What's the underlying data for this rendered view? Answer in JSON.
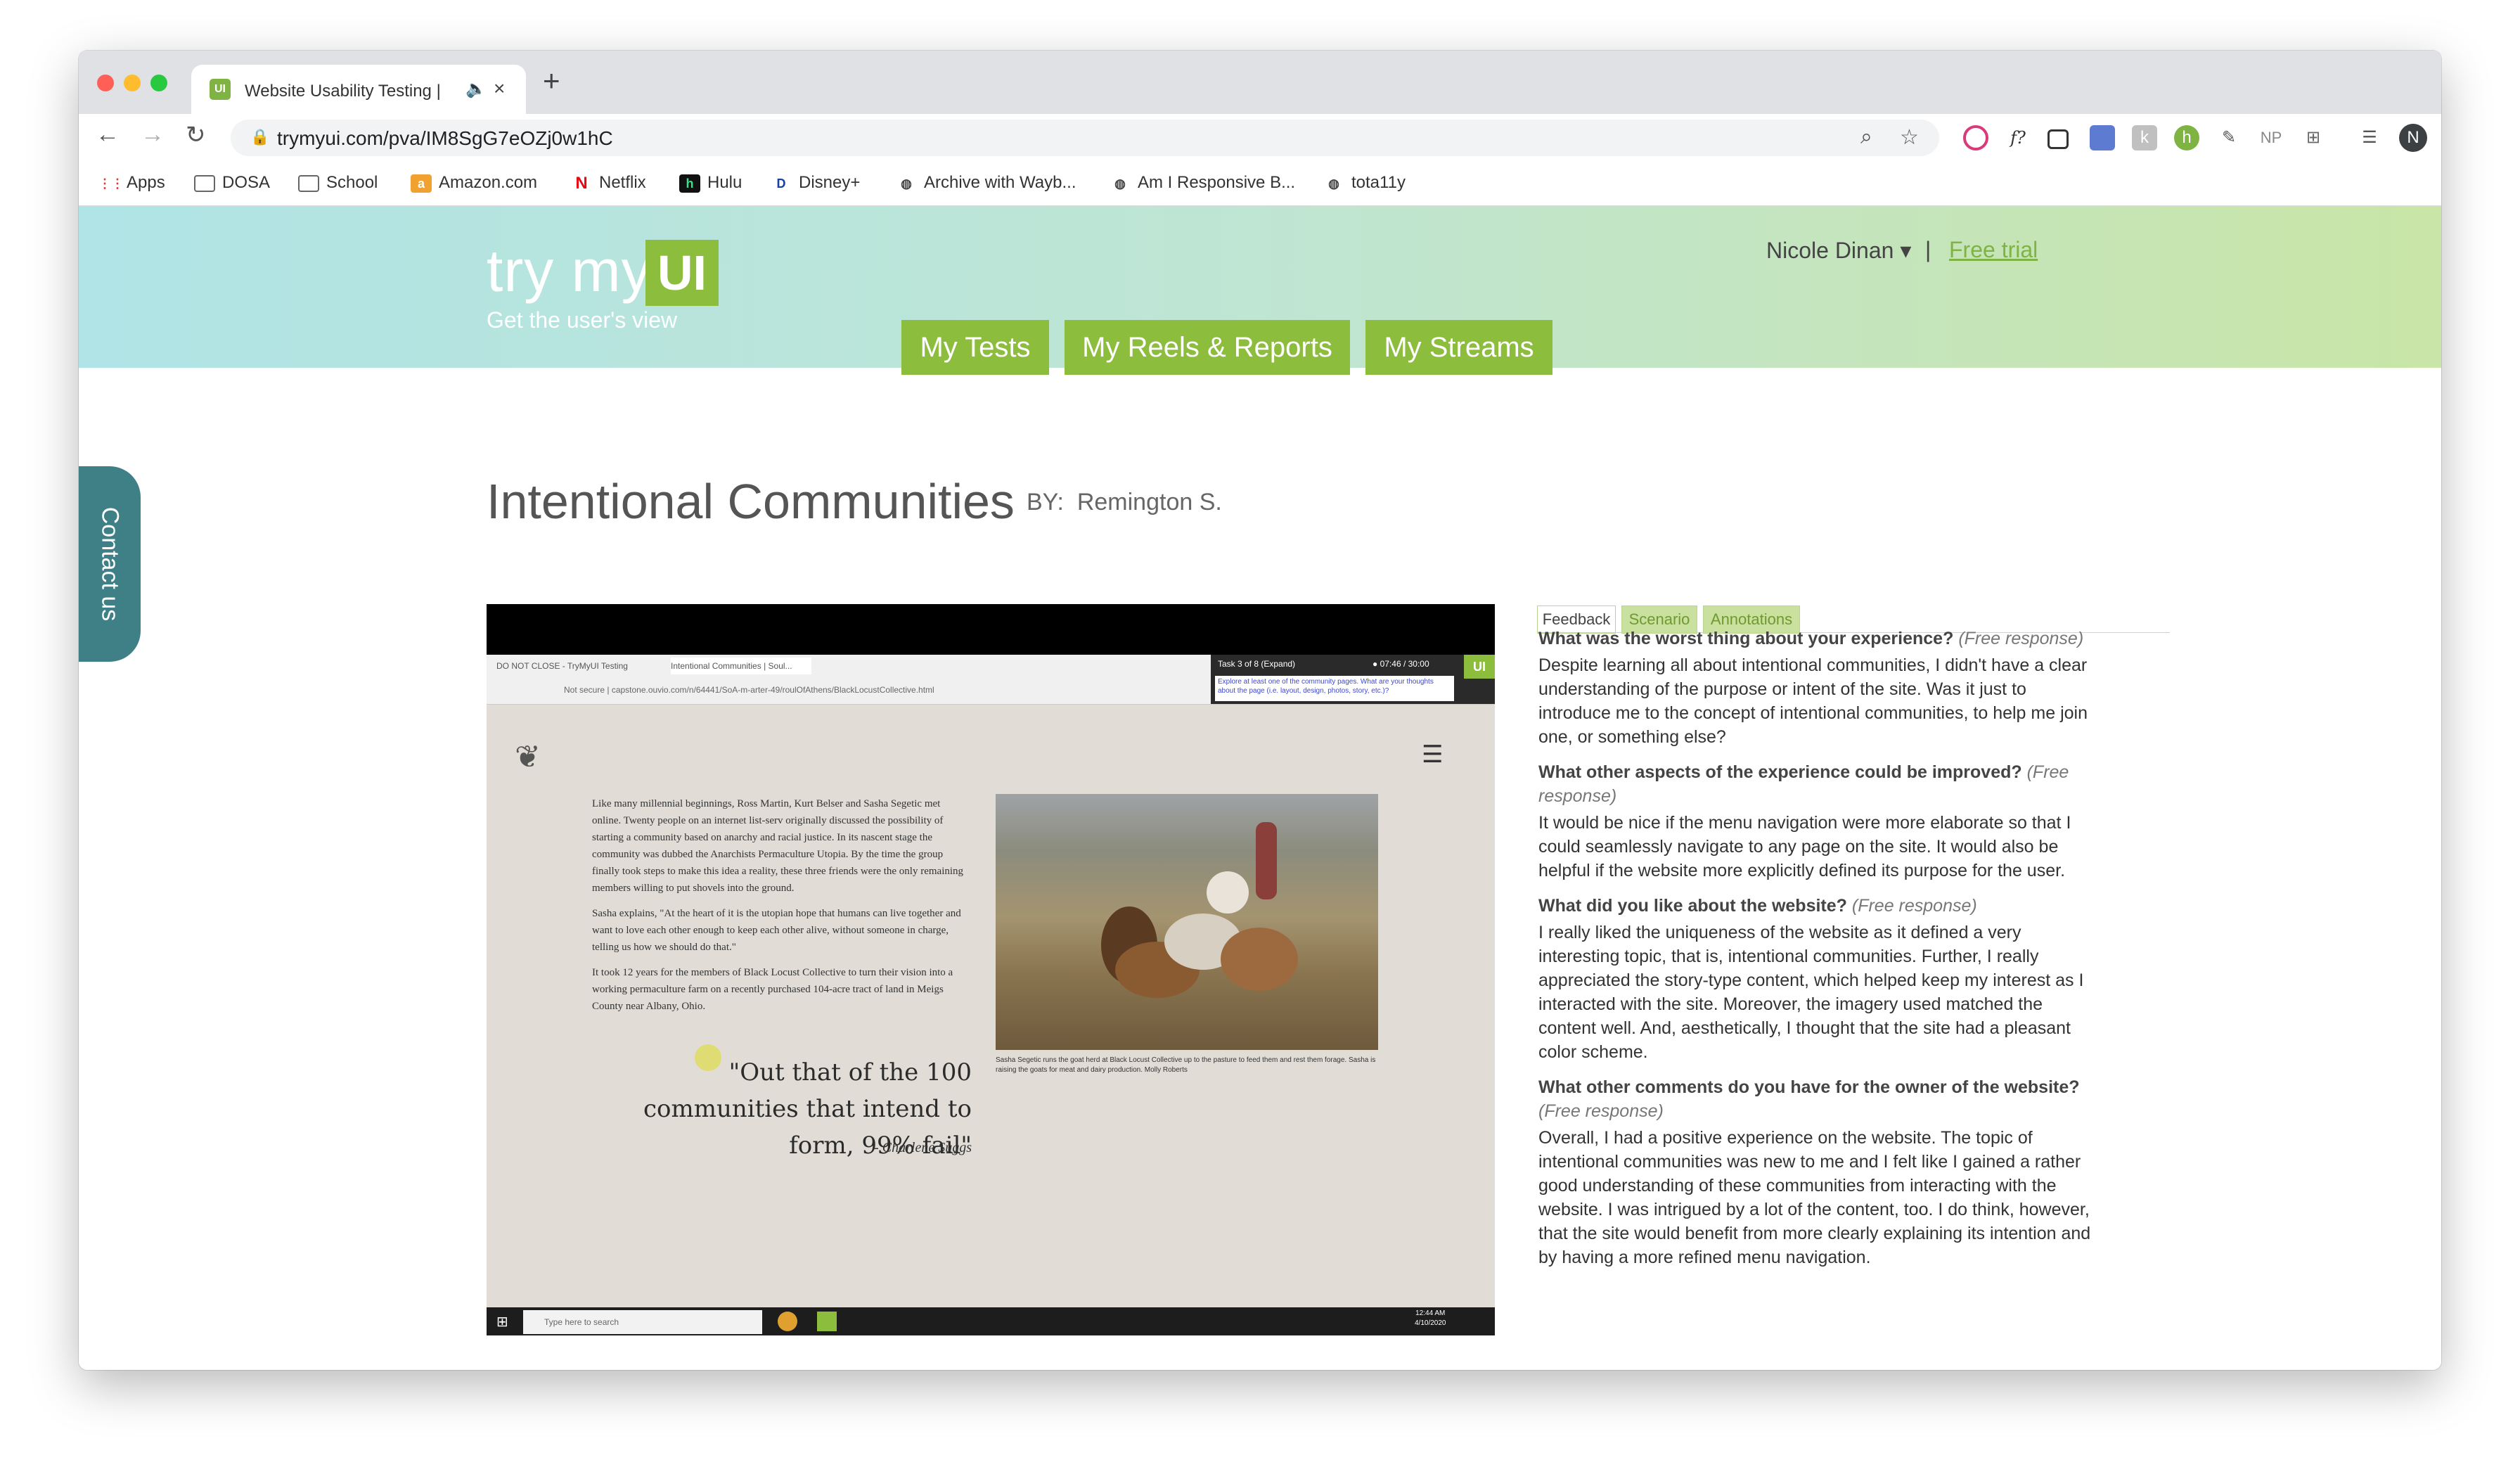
{
  "browser": {
    "tab_title": "Website Usability Testing |",
    "tab_favicon": "UI",
    "url": "trymyui.com/pva/IM8SgG7eOZj0w1hC",
    "profile_initial": "N",
    "ext_np": "NP",
    "ext_fx": "f?"
  },
  "bookmarks": [
    {
      "icon": "apps-grid-icon",
      "label": "Apps"
    },
    {
      "icon": "folder-icon",
      "label": "DOSA"
    },
    {
      "icon": "folder-icon",
      "label": "School"
    },
    {
      "icon": "amazon-icon",
      "label": "Amazon.com"
    },
    {
      "icon": "netflix-icon",
      "label": "Netflix"
    },
    {
      "icon": "hulu-icon",
      "label": "Hulu"
    },
    {
      "icon": "disney-icon",
      "label": "Disney+"
    },
    {
      "icon": "globe-icon",
      "label": "Archive with Wayb..."
    },
    {
      "icon": "globe-icon",
      "label": "Am I Responsive B..."
    },
    {
      "icon": "globe-icon",
      "label": "tota11y"
    }
  ],
  "header": {
    "logo_text": "try my",
    "logo_box": "UI",
    "tagline": "Get the user's view",
    "nav": [
      "My Tests",
      "My Reels & Reports",
      "My Streams"
    ],
    "user": "Nicole Dinan ▾",
    "separator": "|",
    "free_trial": "Free trial"
  },
  "contact_label": "Contact us",
  "test": {
    "title": "Intentional Communities",
    "by_label": "BY:",
    "author": "Remington S."
  },
  "video": {
    "tabs": [
      "DO NOT CLOSE - TryMyUI Testing",
      "Intentional Communities | Soul..."
    ],
    "url": "capstone.ouvio.com/n/64441/SoA-m-arter-49/roulOfAthens/BlackLocustCollective.html",
    "url_prefix": "Not secure",
    "task_label": "Task 3 of 8 (Expand)",
    "task_time": "● 07:46 / 30:00",
    "task_note": "Explore at least one of the community pages. What are your thoughts about the page (i.e. layout, design, photos, story, etc.)?",
    "task_badge": "UI",
    "article": [
      "Like many millennial beginnings, Ross Martin, Kurt Belser and Sasha Segetic met online. Twenty people on an internet list-serv originally discussed the possibility of starting a community based on anarchy and racial justice. In its nascent stage the community was dubbed the Anarchists Permaculture Utopia. By the time the group finally took steps to make this idea a reality, these three friends were the only remaining members willing to put shovels into the ground.",
      "Sasha explains, \"At the heart of it is the utopian hope that humans can live together and want to love each other enough to keep each other alive, without someone in charge, telling us how we should do that.\"",
      "It took 12 years for the members of Black Locust Collective to turn their vision into a working permaculture farm on a recently purchased 104-acre tract of land in Meigs County near Albany, Ohio."
    ],
    "quote": "\"Out that of the 100 communities that intend to form, 99% fail\"",
    "quote_author": "- Charlene Suggs",
    "caption": "Sasha Segetic runs the goat herd at Black Locust Collective up to the pasture to feed them and rest them forage. Sasha is raising the goats for meat and dairy production. Molly Roberts",
    "search_placeholder": "Type here to search",
    "clock_time": "12:44 AM",
    "clock_date": "4/10/2020"
  },
  "feedback": {
    "tabs": [
      "Feedback",
      "Scenario",
      "Annotations"
    ],
    "items": [
      {
        "question": "What was the worst thing about your experience?",
        "hint": "(Free response)",
        "answer": "Despite learning all about intentional communities, I didn't have a clear understanding of the purpose or intent of the site.  Was it just to introduce me to the concept of intentional communities, to help me join one, or something else?"
      },
      {
        "question": "What other aspects of the experience could be improved?",
        "hint": "(Free response)",
        "answer": "It would be nice if the menu navigation were more elaborate so that I could seamlessly navigate to any page on the site.  It would also be helpful if the website more explicitly defined its purpose for the user."
      },
      {
        "question": "What did you like about the website?",
        "hint": "(Free response)",
        "answer": "I really liked the uniqueness of the website as it defined a very interesting topic, that is, intentional communities.  Further, I really appreciated the story-type content, which helped keep my interest as I interacted with the site.  Moreover, the imagery used matched the content well.  And, aesthetically, I thought that the site had a pleasant color scheme."
      },
      {
        "question": "What other comments do you have for the owner of the website?",
        "hint": "(Free response)",
        "answer": "Overall, I had a positive experience on the website.  The topic of intentional communities was new to me and I felt like I gained a rather good understanding of these communities from interacting with the website.  I was intrigued by a lot of the content, too.  I do think, however, that the site would benefit from more clearly explaining its intention and by having a more refined menu navigation."
      }
    ]
  },
  "colors": {
    "brand_green": "#8dbd3d",
    "contact_teal": "#3f7f86",
    "header_left": "#b0e4e6",
    "header_right": "#c9e5a7"
  }
}
